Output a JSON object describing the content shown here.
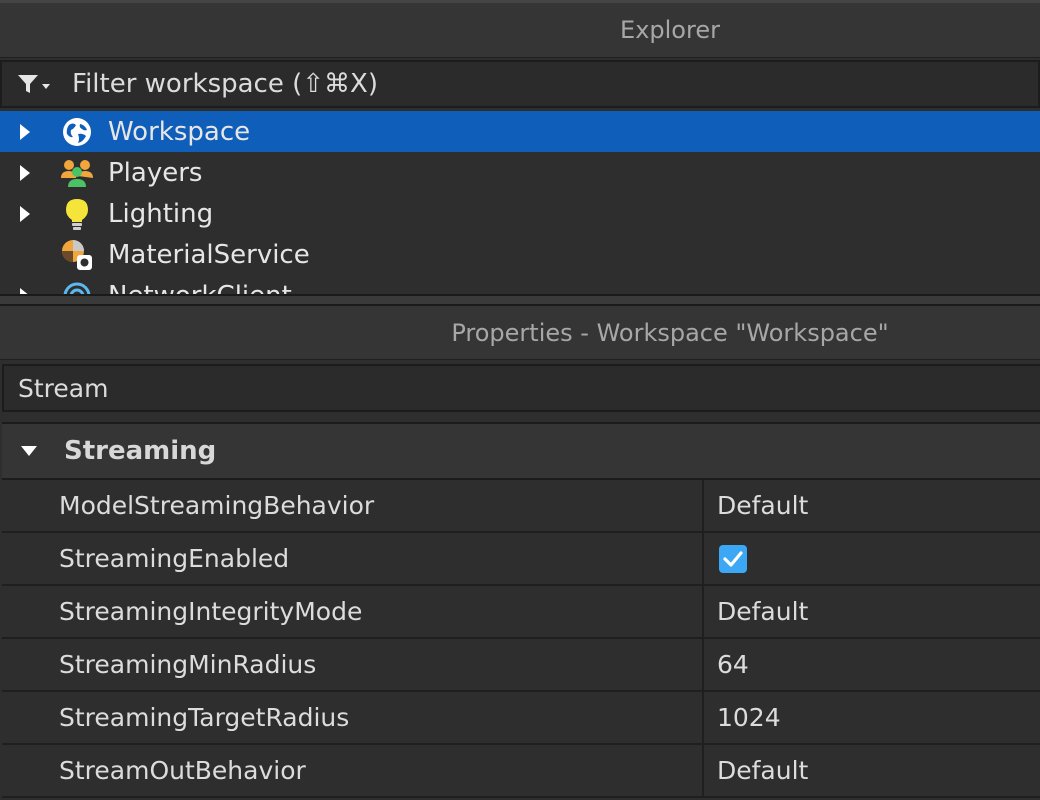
{
  "explorer": {
    "title": "Explorer",
    "filter_placeholder": "Filter workspace (⇧⌘X)",
    "items": [
      {
        "label": "Workspace",
        "icon": "globe-icon",
        "expandable": true,
        "selected": true
      },
      {
        "label": "Players",
        "icon": "players-icon",
        "expandable": true,
        "selected": false
      },
      {
        "label": "Lighting",
        "icon": "lightbulb-icon",
        "expandable": true,
        "selected": false
      },
      {
        "label": "MaterialService",
        "icon": "material-service-icon",
        "expandable": false,
        "selected": false
      },
      {
        "label": "NetworkClient",
        "icon": "network-client-icon",
        "expandable": true,
        "selected": false
      }
    ]
  },
  "properties": {
    "title": "Properties - Workspace \"Workspace\"",
    "search_value": "Stream",
    "section": {
      "label": "Streaming",
      "expanded": true
    },
    "rows": [
      {
        "name": "ModelStreamingBehavior",
        "value": "Default"
      },
      {
        "name": "StreamingEnabled",
        "value": "",
        "checked": true
      },
      {
        "name": "StreamingIntegrityMode",
        "value": "Default"
      },
      {
        "name": "StreamingMinRadius",
        "value": "64"
      },
      {
        "name": "StreamingTargetRadius",
        "value": "1024"
      },
      {
        "name": "StreamOutBehavior",
        "value": "Default"
      }
    ]
  },
  "colors": {
    "selection": "#0f5fba",
    "checkbox": "#3ba7f5",
    "panel_bg": "#2e2e2e"
  }
}
